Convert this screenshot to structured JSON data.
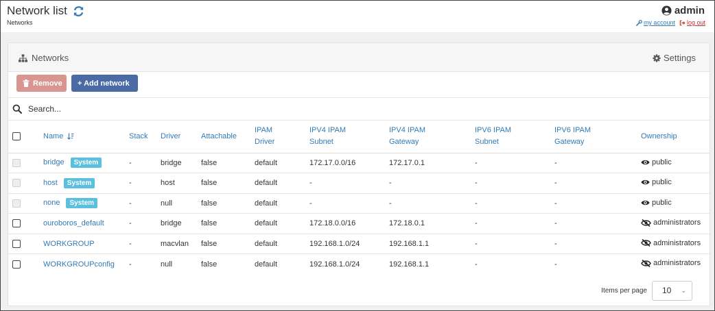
{
  "header": {
    "title": "Network list",
    "breadcrumb": "Networks",
    "user": "admin",
    "my_account": "my account",
    "logout": "log out"
  },
  "widget": {
    "title": "Networks",
    "settings": "Settings"
  },
  "actions": {
    "remove": "Remove",
    "add": "+ Add network"
  },
  "search": {
    "placeholder": "Search..."
  },
  "table": {
    "columns": {
      "name": "Name",
      "stack": "Stack",
      "driver": "Driver",
      "attachable": "Attachable",
      "ipam_driver_1": "IPAM",
      "ipam_driver_2": "Driver",
      "ipv4_subnet_1": "IPV4 IPAM",
      "ipv4_subnet_2": "Subnet",
      "ipv4_gateway_1": "IPV4 IPAM",
      "ipv4_gateway_2": "Gateway",
      "ipv6_subnet_1": "IPV6 IPAM",
      "ipv6_subnet_2": "Subnet",
      "ipv6_gateway_1": "IPV6 IPAM",
      "ipv6_gateway_2": "Gateway",
      "ownership": "Ownership"
    },
    "rows": [
      {
        "name": "bridge",
        "badge": "System",
        "stack": "-",
        "driver": "bridge",
        "attachable": "false",
        "ipam_driver": "default",
        "ipv4_subnet": "172.17.0.0/16",
        "ipv4_gateway": "172.17.0.1",
        "ipv6_subnet": "-",
        "ipv6_gateway": "-",
        "ownership": "public"
      },
      {
        "name": "host",
        "badge": "System",
        "stack": "-",
        "driver": "host",
        "attachable": "false",
        "ipam_driver": "default",
        "ipv4_subnet": "-",
        "ipv4_gateway": "-",
        "ipv6_subnet": "-",
        "ipv6_gateway": "-",
        "ownership": "public"
      },
      {
        "name": "none",
        "badge": "System",
        "stack": "-",
        "driver": "null",
        "attachable": "false",
        "ipam_driver": "default",
        "ipv4_subnet": "-",
        "ipv4_gateway": "-",
        "ipv6_subnet": "-",
        "ipv6_gateway": "-",
        "ownership": "public"
      },
      {
        "name": "ouroboros_default",
        "badge": "",
        "stack": "-",
        "driver": "bridge",
        "attachable": "false",
        "ipam_driver": "default",
        "ipv4_subnet": "172.18.0.0/16",
        "ipv4_gateway": "172.18.0.1",
        "ipv6_subnet": "-",
        "ipv6_gateway": "-",
        "ownership": "administrators"
      },
      {
        "name": "WORKGROUP",
        "badge": "",
        "stack": "-",
        "driver": "macvlan",
        "attachable": "false",
        "ipam_driver": "default",
        "ipv4_subnet": "192.168.1.0/24",
        "ipv4_gateway": "192.168.1.1",
        "ipv6_subnet": "-",
        "ipv6_gateway": "-",
        "ownership": "administrators"
      },
      {
        "name": "WORKGROUPconfig",
        "badge": "",
        "stack": "-",
        "driver": "null",
        "attachable": "false",
        "ipam_driver": "default",
        "ipv4_subnet": "192.168.1.0/24",
        "ipv4_gateway": "192.168.1.1",
        "ipv6_subnet": "-",
        "ipv6_gateway": "-",
        "ownership": "administrators"
      }
    ]
  },
  "pagination": {
    "label": "Items per page",
    "value": "10"
  },
  "colors": {
    "link": "#337ab7",
    "badge": "#5bc0de",
    "remove_button": "#d9958f",
    "add_button": "#4a6ba3",
    "logout": "#c9302c"
  }
}
